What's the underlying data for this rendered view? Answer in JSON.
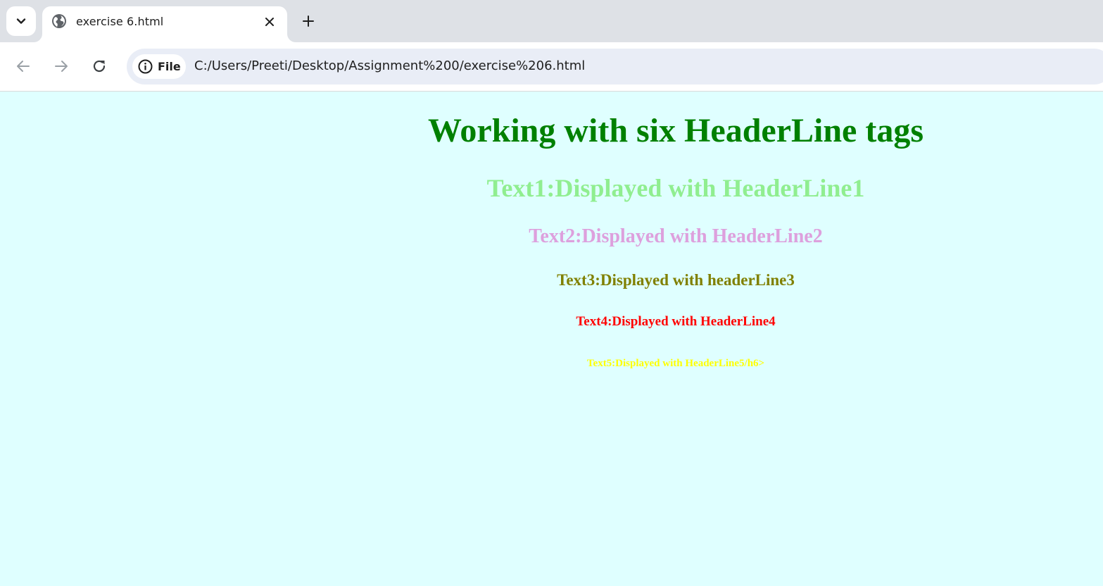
{
  "browser": {
    "tab": {
      "title": "exercise 6.html"
    },
    "omnibox": {
      "chip_label": "File",
      "url": "C:/Users/Preeti/Desktop/Assignment%200/exercise%206.html"
    }
  },
  "page": {
    "background": "#dfffff",
    "headings": [
      {
        "text": "Working with six HeaderLine tags",
        "color": "#008000"
      },
      {
        "text": "Text1:Displayed with HeaderLine1",
        "color": "#90ee90"
      },
      {
        "text": "Text2:Displayed with HeaderLine2",
        "color": "#dda0dd"
      },
      {
        "text": "Text3:Displayed with headerLine3",
        "color": "#808000"
      },
      {
        "text": "Text4:Displayed with HeaderLine4",
        "color": "#ff0000"
      },
      {
        "text": "Text5:Displayed with HeaderLine5/h6>",
        "color": "#ffff00"
      }
    ]
  }
}
